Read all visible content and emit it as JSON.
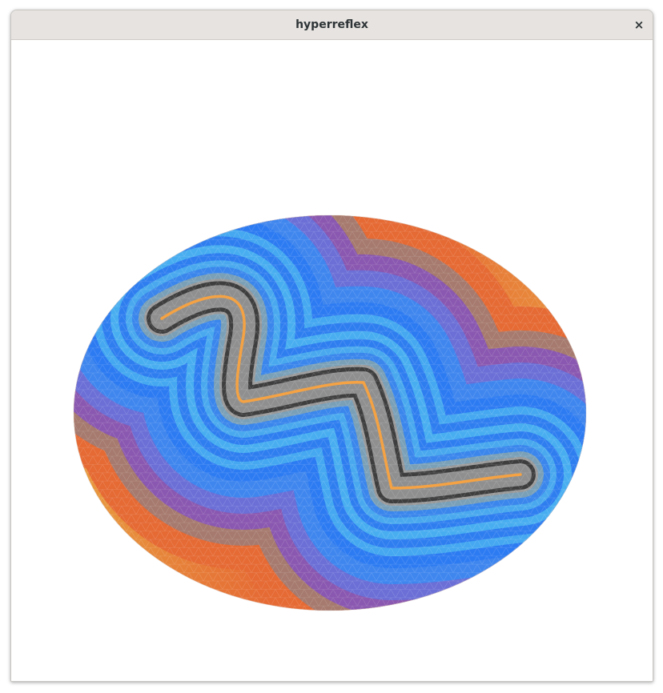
{
  "window": {
    "title": "hyperreflex",
    "close_glyph": "×",
    "close_icon": "close-icon"
  },
  "visualization": {
    "description_type": "distance-field contour mesh on elliptical domain with geodesic path",
    "colors": {
      "near": "#2d7bf2",
      "cyan_band": "#45a8f0",
      "purple_band": "#8a58b0",
      "gray_band": "#9a9a9a",
      "far": "#e45730",
      "far_alt": "#e8a040",
      "ridge": "#2e2e2e",
      "path": "#f4a243"
    }
  }
}
